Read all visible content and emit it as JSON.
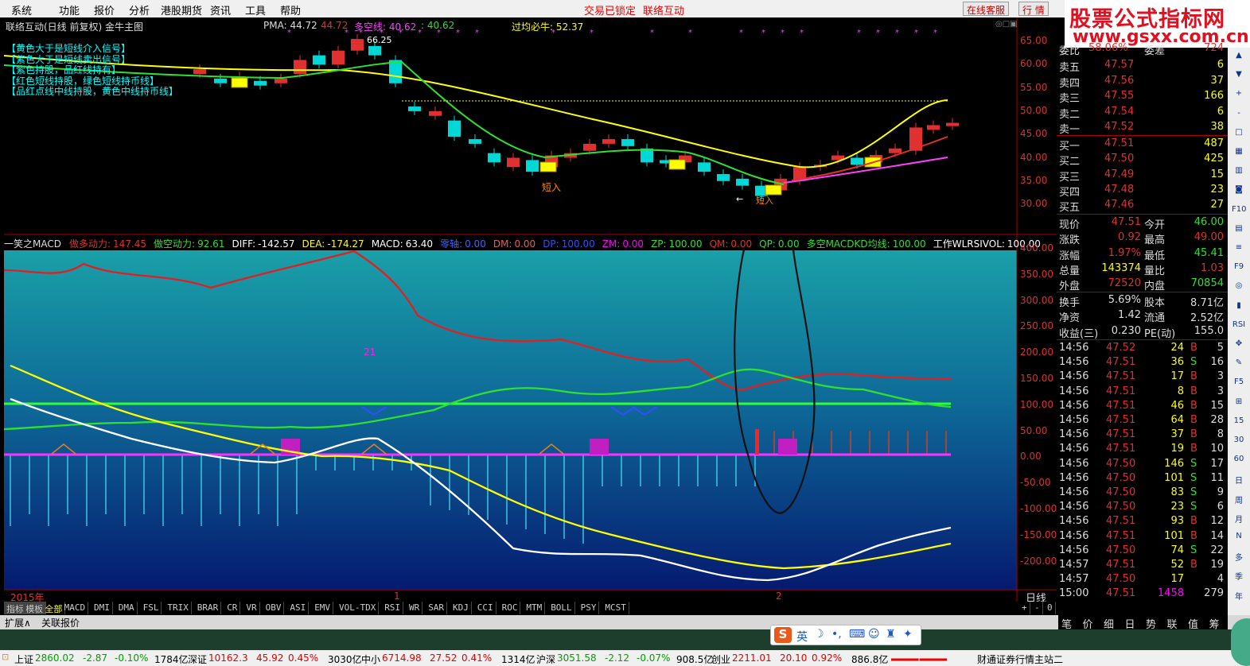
{
  "menu": {
    "items": [
      "系统",
      "功能",
      "报价",
      "分析",
      "港股期货",
      "资讯",
      "工具",
      "帮助"
    ],
    "center_notice": [
      "交易已锁定",
      "联络互动"
    ],
    "right_buttons": [
      "在线客服",
      "行 情"
    ]
  },
  "banner": {
    "title": "股票公式指标网",
    "url": "www.gsxx.com.cn"
  },
  "main_chart": {
    "header_title": "联络互动(日线 前复权) 金牛主图",
    "pma_label": "PMA: 44.72",
    "pma_val": "44.72",
    "duokong_label": "多空线: 40.62",
    "duokong_val": ": 40.62",
    "guojun_label": "过均必牛: 52.37",
    "legend_lines": [
      "【黄色大于是短线介入信号】",
      "【紫色大于是短线卖出信号】",
      "【紫色持股，品红线持有】",
      "【红色短线持股，绿色短线持币线】",
      "【品红点线中线持股，黄色中线持币线】"
    ],
    "y_ticks": [
      "65.00",
      "60.00",
      "55.00",
      "50.00",
      "45.00",
      "40.00",
      "35.00",
      "30.00"
    ],
    "annotations": {
      "peak": "66.25",
      "buy1": "短入",
      "buy2": "←",
      "buy3": "短入"
    }
  },
  "macd_panel": {
    "title": "一笑之MACD",
    "items": [
      {
        "label": "做多动力:",
        "value": "147.45",
        "color": "#e03030"
      },
      {
        "label": "做空动力:",
        "value": "92.61",
        "color": "#30e030"
      },
      {
        "label": "DIFF:",
        "value": "-142.57",
        "color": "#ffffff"
      },
      {
        "label": "DEA:",
        "value": "-174.27",
        "color": "#ffff00"
      },
      {
        "label": "MACD:",
        "value": "63.40",
        "color": "#ffffff"
      },
      {
        "label": "零轴:",
        "value": "0.00",
        "color": "#4060ff"
      },
      {
        "label": "DM:",
        "value": "0.00",
        "color": "#e06060"
      },
      {
        "label": "DP:",
        "value": "100.00",
        "color": "#3050ff"
      },
      {
        "label": "ZM:",
        "value": "0.00",
        "color": "#ff00ff"
      },
      {
        "label": "ZP:",
        "value": "100.00",
        "color": "#30e030"
      },
      {
        "label": "QM:",
        "value": "0.00",
        "color": "#e03030"
      },
      {
        "label": "QP:",
        "value": "0.00",
        "color": "#30e030"
      },
      {
        "label": "多空MACDKD均线:",
        "value": "100.00",
        "color": "#30e030"
      },
      {
        "label": "工作WLRSIVOL:",
        "value": "100.00",
        "color": "#ffffff"
      }
    ],
    "y_ticks": [
      "400.00",
      "350.00",
      "300.00",
      "250.00",
      "200.00",
      "150.00",
      "100.00",
      "50.00",
      "0.00",
      "-50.00",
      "-100.00",
      "-150.00",
      "-200.00"
    ],
    "marker_21": "21",
    "time_labels": {
      "year": "2015年",
      "m1": "1",
      "m2": "2",
      "period": "日线"
    }
  },
  "tabs": {
    "row1": [
      "指标",
      "模板",
      "全部",
      "MACD",
      "DMI",
      "DMA",
      "FSL",
      "TRIX",
      "BRAR",
      "CR",
      "VR",
      "OBV",
      "ASI",
      "EMV",
      "VOL-TDX",
      "RSI",
      "WR",
      "SAR",
      "KDJ",
      "CCI",
      "ROC",
      "MTM",
      "BOLL",
      "PSY",
      "MCST"
    ],
    "right": [
      "+",
      "-",
      "0"
    ],
    "row2": [
      "扩展∧",
      "关联报价"
    ]
  },
  "quote_panel": {
    "weibi": {
      "label": "委比",
      "value": "58.06%",
      "label2": "委差",
      "value2": "724"
    },
    "asks": [
      {
        "label": "卖五",
        "price": "47.57",
        "vol": "6"
      },
      {
        "label": "卖四",
        "price": "47.56",
        "vol": "37"
      },
      {
        "label": "卖三",
        "price": "47.55",
        "vol": "166"
      },
      {
        "label": "卖二",
        "price": "47.54",
        "vol": "6"
      },
      {
        "label": "卖一",
        "price": "47.52",
        "vol": "38"
      }
    ],
    "bids": [
      {
        "label": "买一",
        "price": "47.51",
        "vol": "487"
      },
      {
        "label": "买二",
        "price": "47.50",
        "vol": "425"
      },
      {
        "label": "买三",
        "price": "47.49",
        "vol": "15"
      },
      {
        "label": "买四",
        "price": "47.48",
        "vol": "23"
      },
      {
        "label": "买五",
        "price": "47.46",
        "vol": "27"
      }
    ],
    "stats": [
      {
        "l1": "现价",
        "v1": "47.51",
        "c1": "#e03030",
        "l2": "今开",
        "v2": "46.00",
        "c2": "#30e030"
      },
      {
        "l1": "涨跌",
        "v1": "0.92",
        "c1": "#e03030",
        "l2": "最高",
        "v2": "49.00",
        "c2": "#e03030"
      },
      {
        "l1": "涨幅",
        "v1": "1.97%",
        "c1": "#e03030",
        "l2": "最低",
        "v2": "45.41",
        "c2": "#30e030"
      },
      {
        "l1": "总量",
        "v1": "143374",
        "c1": "#ffff00",
        "l2": "量比",
        "v2": "1.03",
        "c2": "#e03030"
      },
      {
        "l1": "外盘",
        "v1": "72520",
        "c1": "#e03030",
        "l2": "内盘",
        "v2": "70854",
        "c2": "#30e030"
      }
    ],
    "fund": [
      {
        "l1": "换手",
        "v1": "5.69%",
        "l2": "股本",
        "v2": "8.71亿"
      },
      {
        "l1": "净资",
        "v1": "1.42",
        "l2": "流通",
        "v2": "2.52亿"
      },
      {
        "l1": "收益(三)",
        "v1": "0.230",
        "l2": "PE(动)",
        "v2": "155.0"
      }
    ],
    "ticks": [
      {
        "t": "14:56",
        "p": "47.52",
        "v": "24",
        "bs": "B",
        "n": "5"
      },
      {
        "t": "14:56",
        "p": "47.51",
        "v": "36",
        "bs": "S",
        "n": "16"
      },
      {
        "t": "14:56",
        "p": "47.51",
        "v": "17",
        "bs": "B",
        "n": "3"
      },
      {
        "t": "14:56",
        "p": "47.51",
        "v": "8",
        "bs": "B",
        "n": "3"
      },
      {
        "t": "14:56",
        "p": "47.51",
        "v": "46",
        "bs": "B",
        "n": "15"
      },
      {
        "t": "14:56",
        "p": "47.51",
        "v": "64",
        "bs": "B",
        "n": "28"
      },
      {
        "t": "14:56",
        "p": "47.51",
        "v": "37",
        "bs": "B",
        "n": "8"
      },
      {
        "t": "14:56",
        "p": "47.51",
        "v": "19",
        "bs": "B",
        "n": "10"
      },
      {
        "t": "14:56",
        "p": "47.50",
        "v": "146",
        "bs": "S",
        "n": "17"
      },
      {
        "t": "14:56",
        "p": "47.50",
        "v": "101",
        "bs": "S",
        "n": "11"
      },
      {
        "t": "14:56",
        "p": "47.50",
        "v": "83",
        "bs": "S",
        "n": "9"
      },
      {
        "t": "14:56",
        "p": "47.50",
        "v": "23",
        "bs": "S",
        "n": "6"
      },
      {
        "t": "14:56",
        "p": "47.51",
        "v": "93",
        "bs": "B",
        "n": "12"
      },
      {
        "t": "14:56",
        "p": "47.51",
        "v": "101",
        "bs": "B",
        "n": "14"
      },
      {
        "t": "14:56",
        "p": "47.50",
        "v": "74",
        "bs": "S",
        "n": "22"
      },
      {
        "t": "14:57",
        "p": "47.51",
        "v": "52",
        "bs": "B",
        "n": "19"
      },
      {
        "t": "14:57",
        "p": "47.50",
        "v": "17",
        "bs": "",
        "n": "4"
      },
      {
        "t": "15:00",
        "p": "47.51",
        "v": "1458",
        "bs": "",
        "n": "279"
      }
    ],
    "bottom_tabs": [
      "笔",
      "价",
      "细",
      "日",
      "势",
      "联",
      "值",
      "筹"
    ]
  },
  "side_icons": [
    "up-arrow-icon",
    "down-arrow-icon",
    "zoom-in-icon",
    "zoom-out-icon",
    "window-icon",
    "chart-icon",
    "kline-icon",
    "print-icon",
    "f10-icon",
    "grid-icon",
    "tick-icon",
    "f9-icon",
    "target-icon",
    "bar-chart-icon",
    "rsi-icon",
    "move-icon",
    "pen-icon",
    "f5-icon",
    "f6-icon",
    "15-icon",
    "30-icon",
    "60-icon",
    "day-icon",
    "week-icon",
    "month-icon",
    "n-icon",
    "multi-icon",
    "season-icon",
    "year-icon"
  ],
  "side_icon_text": [
    "▲",
    "▼",
    "+",
    "-",
    "□",
    "▦",
    "▥",
    "◙",
    "F10",
    "▤",
    "≡",
    "F9",
    "◎",
    "▮",
    "RSI",
    "✥",
    "✎",
    "F5",
    "⊞",
    "15",
    "30",
    "60",
    "日",
    "周",
    "月",
    "N",
    "多",
    "季",
    "年"
  ],
  "status_bar": [
    {
      "label": "上证",
      "value": "2860.02",
      "chg": "-2.87",
      "pct": "-0.10%",
      "amt": "1784亿"
    },
    {
      "label": "深证",
      "value": "10162.3",
      "chg": "45.92",
      "pct": "0.45%",
      "amt": "3030亿"
    },
    {
      "label": "中小",
      "value": "6714.98",
      "chg": "27.52",
      "pct": "0.41%",
      "amt": "1314亿"
    },
    {
      "label": "沪深",
      "value": "3051.58",
      "chg": "-2.12",
      "pct": "-0.07%",
      "amt": "908.5亿"
    },
    {
      "label": "创业",
      "value": "2211.01",
      "chg": "20.10",
      "pct": "0.92%",
      "amt": "886.8亿"
    }
  ],
  "status_right": "财通证券行情主站二",
  "ime": {
    "lang": "英"
  },
  "colors": {
    "bg": "#000000",
    "up": "#e03030",
    "down": "#00d8d8",
    "yellow": "#ffff00",
    "green": "#30e030",
    "magenta": "#ff00ff"
  }
}
